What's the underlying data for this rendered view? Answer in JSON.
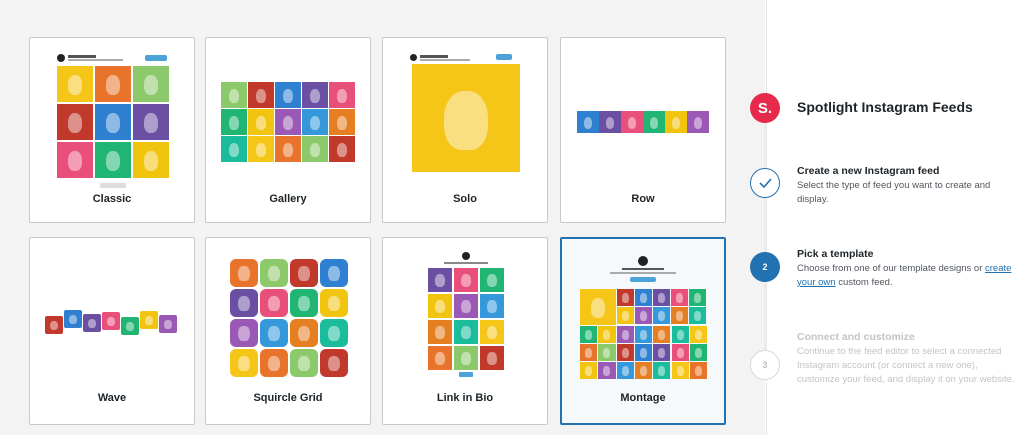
{
  "templates": [
    {
      "label": "Classic"
    },
    {
      "label": "Gallery"
    },
    {
      "label": "Solo"
    },
    {
      "label": "Row"
    },
    {
      "label": "Wave"
    },
    {
      "label": "Squircle Grid"
    },
    {
      "label": "Link in Bio"
    },
    {
      "label": "Montage",
      "selected": true
    }
  ],
  "sidebar": {
    "logo_letter": "S.",
    "title": "Spotlight Instagram Feeds",
    "steps": [
      {
        "number": "✓",
        "title": "Create a new Instagram feed",
        "description": "Select the type of feed you want to create and display.",
        "state": "done"
      },
      {
        "number": "2",
        "title": "Pick a template",
        "description_before": "Choose from one of our template designs or ",
        "link": "create your own",
        "description_after": " custom feed.",
        "state": "active"
      },
      {
        "number": "3",
        "title": "Connect and customize",
        "description": "Continue to the feed editor to select a connected Instagram account (or connect a new one), customize your feed, and display it on your website.",
        "state": "todo"
      }
    ]
  },
  "colors": {
    "accent": "#2271b1",
    "brand": "#e7294b",
    "tiles": [
      "#f5c518",
      "#e8732a",
      "#8cc96b",
      "#c0392b",
      "#2f80d1",
      "#6a4fa3",
      "#e94f7b",
      "#21b573",
      "#f1c40f",
      "#9b59b6",
      "#3498db",
      "#e67e22",
      "#1abc9c"
    ]
  }
}
